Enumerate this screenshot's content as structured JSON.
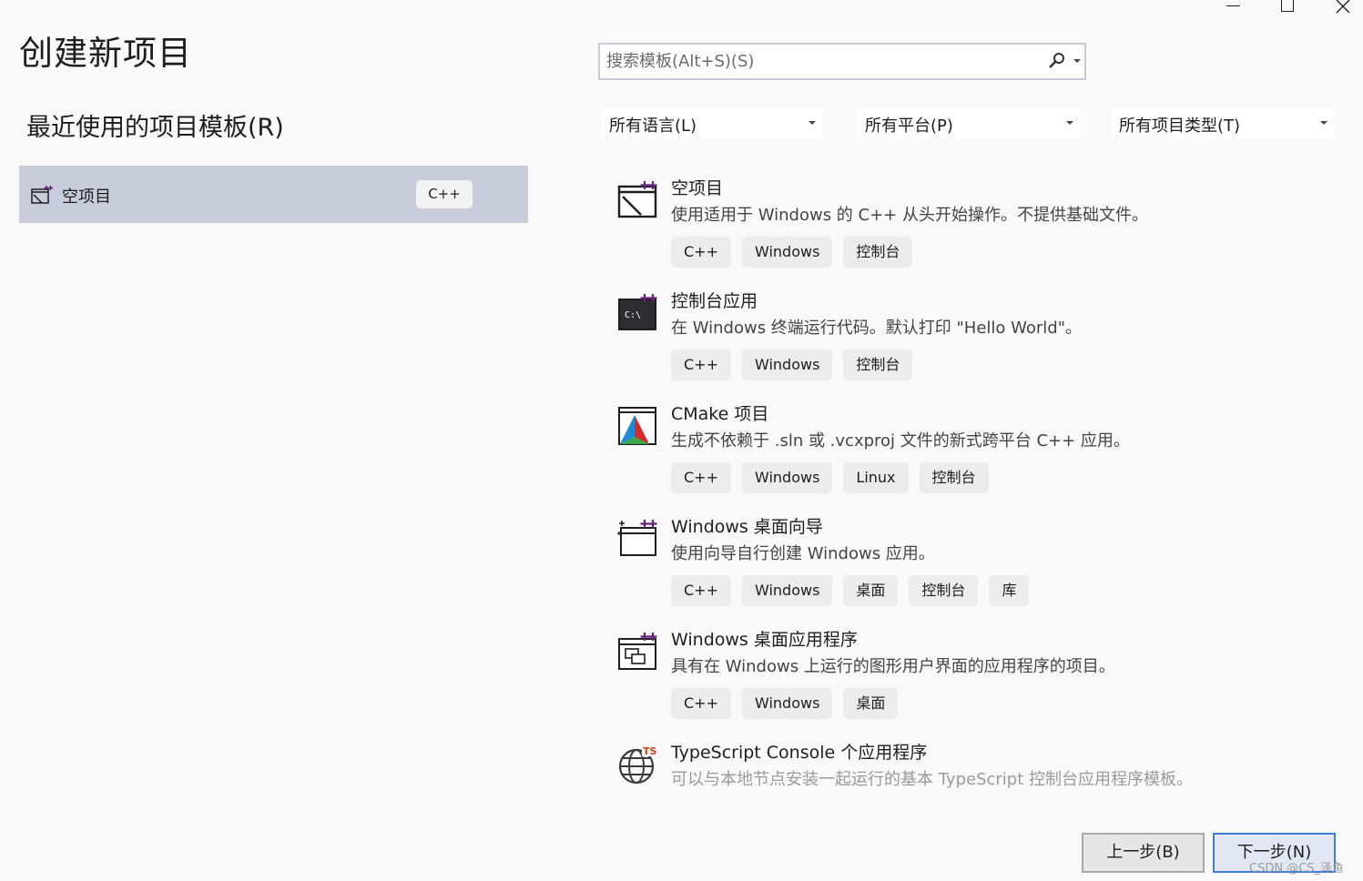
{
  "window": {
    "title": "创建新项目"
  },
  "recent": {
    "heading": "最近使用的项目模板(R)",
    "items": [
      {
        "label": "空项目",
        "tag": "C++"
      }
    ]
  },
  "search": {
    "placeholder": "搜索模板(Alt+S)(S)"
  },
  "filters": {
    "language": "所有语言(L)",
    "platform": "所有平台(P)",
    "project_type": "所有项目类型(T)"
  },
  "templates": [
    {
      "icon": "empty-project-icon",
      "title": "空项目",
      "description": "使用适用于 Windows 的 C++ 从头开始操作。不提供基础文件。",
      "tags": [
        "C++",
        "Windows",
        "控制台"
      ]
    },
    {
      "icon": "console-app-icon",
      "title": "控制台应用",
      "description": "在 Windows 终端运行代码。默认打印 \"Hello World\"。",
      "tags": [
        "C++",
        "Windows",
        "控制台"
      ]
    },
    {
      "icon": "cmake-icon",
      "title": "CMake 项目",
      "description": "生成不依赖于 .sln 或 .vcxproj 文件的新式跨平台 C++ 应用。",
      "tags": [
        "C++",
        "Windows",
        "Linux",
        "控制台"
      ]
    },
    {
      "icon": "desktop-wizard-icon",
      "title": "Windows 桌面向导",
      "description": "使用向导自行创建 Windows 应用。",
      "tags": [
        "C++",
        "Windows",
        "桌面",
        "控制台",
        "库"
      ]
    },
    {
      "icon": "desktop-app-icon",
      "title": "Windows 桌面应用程序",
      "description": "具有在 Windows 上运行的图形用户界面的应用程序的项目。",
      "tags": [
        "C++",
        "Windows",
        "桌面"
      ]
    },
    {
      "icon": "typescript-globe-icon",
      "title": "TypeScript Console 个应用程序",
      "description": "可以与本地节点安装一起运行的基本 TypeScript 控制台应用程序模板。",
      "tags": []
    }
  ],
  "buttons": {
    "back": "上一步(B)",
    "next": "下一步(N)"
  },
  "watermark": "CSDN @CS_泽鱼",
  "colors": {
    "selected_bg": "#c9ccda",
    "accent_border": "#3c7fd8",
    "plus_purple": "#68217a"
  }
}
